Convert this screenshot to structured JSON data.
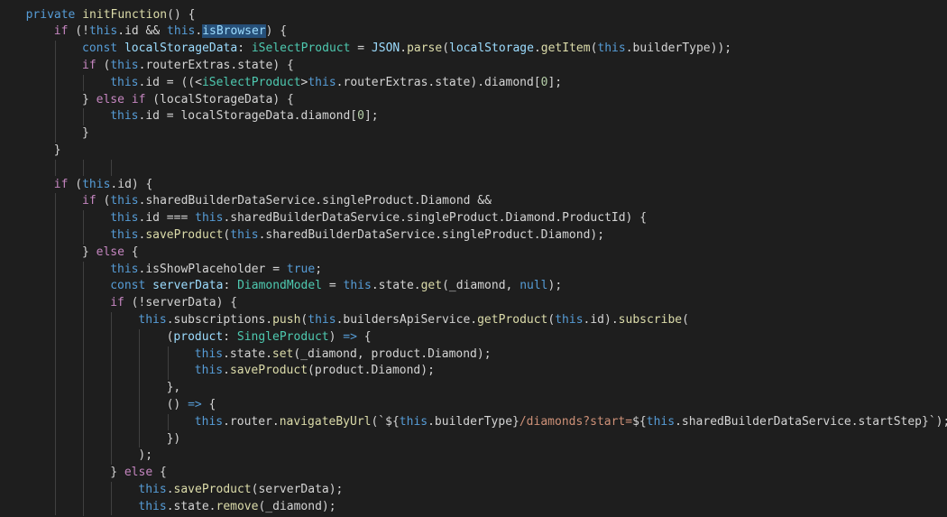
{
  "colors": {
    "background": "#1e1e1e",
    "keyword": "#569cd6",
    "control": "#c586c0",
    "function": "#dcdcaa",
    "variable": "#9cdcfe",
    "type": "#4ec9b0",
    "number": "#b5cea8",
    "string": "#ce9178",
    "text": "#d4d4d4",
    "selection": "#264f78"
  },
  "code_lines": [
    {
      "indent": 2,
      "tokens": [
        [
          "private ",
          "kw"
        ],
        [
          "initFunction",
          "fn"
        ],
        [
          "() {",
          "p"
        ]
      ]
    },
    {
      "indent": 6,
      "tokens": [
        [
          "if ",
          "ctl"
        ],
        [
          "(!",
          "p"
        ],
        [
          "this",
          "kw"
        ],
        [
          ".id && ",
          "p"
        ],
        [
          "this",
          "kw"
        ],
        [
          ".",
          "p"
        ],
        [
          "isBrowser",
          "sel"
        ],
        [
          ") {",
          "p"
        ]
      ]
    },
    {
      "indent": 10,
      "tokens": [
        [
          "const ",
          "kw"
        ],
        [
          "localStorageData",
          "var"
        ],
        [
          ": ",
          "p"
        ],
        [
          "iSelectProduct",
          "ty"
        ],
        [
          " = ",
          "p"
        ],
        [
          "JSON",
          "var"
        ],
        [
          ".",
          "p"
        ],
        [
          "parse",
          "fn"
        ],
        [
          "(",
          "p"
        ],
        [
          "localStorage",
          "var"
        ],
        [
          ".",
          "p"
        ],
        [
          "getItem",
          "fn"
        ],
        [
          "(",
          "p"
        ],
        [
          "this",
          "kw"
        ],
        [
          ".builderType));",
          "p"
        ]
      ]
    },
    {
      "indent": 10,
      "tokens": [
        [
          "if ",
          "ctl"
        ],
        [
          "(",
          "p"
        ],
        [
          "this",
          "kw"
        ],
        [
          ".routerExtras.state) {",
          "p"
        ]
      ]
    },
    {
      "indent": 14,
      "tokens": [
        [
          "this",
          "kw"
        ],
        [
          ".id = ((<",
          "p"
        ],
        [
          "iSelectProduct",
          "ty"
        ],
        [
          ">",
          "p"
        ],
        [
          "this",
          "kw"
        ],
        [
          ".routerExtras.state).diamond[",
          "p"
        ],
        [
          "0",
          "num"
        ],
        [
          "];",
          "p"
        ]
      ]
    },
    {
      "indent": 10,
      "tokens": [
        [
          "} ",
          "p"
        ],
        [
          "else if ",
          "ctl"
        ],
        [
          "(localStorageData) {",
          "p"
        ]
      ]
    },
    {
      "indent": 14,
      "tokens": [
        [
          "this",
          "kw"
        ],
        [
          ".id = localStorageData.diamond[",
          "p"
        ],
        [
          "0",
          "num"
        ],
        [
          "];",
          "p"
        ]
      ]
    },
    {
      "indent": 10,
      "tokens": [
        [
          "}",
          "p"
        ]
      ]
    },
    {
      "indent": 6,
      "tokens": [
        [
          "}",
          "p"
        ]
      ]
    },
    {
      "indent": 0,
      "tokens": []
    },
    {
      "indent": 6,
      "tokens": [
        [
          "if ",
          "ctl"
        ],
        [
          "(",
          "p"
        ],
        [
          "this",
          "kw"
        ],
        [
          ".id) {",
          "p"
        ]
      ]
    },
    {
      "indent": 10,
      "tokens": [
        [
          "if ",
          "ctl"
        ],
        [
          "(",
          "p"
        ],
        [
          "this",
          "kw"
        ],
        [
          ".sharedBuilderDataService.singleProduct.Diamond &&",
          "p"
        ]
      ]
    },
    {
      "indent": 14,
      "tokens": [
        [
          "this",
          "kw"
        ],
        [
          ".id === ",
          "p"
        ],
        [
          "this",
          "kw"
        ],
        [
          ".sharedBuilderDataService.singleProduct.Diamond.ProductId) {",
          "p"
        ]
      ]
    },
    {
      "indent": 14,
      "tokens": [
        [
          "this",
          "kw"
        ],
        [
          ".",
          "p"
        ],
        [
          "saveProduct",
          "fn"
        ],
        [
          "(",
          "p"
        ],
        [
          "this",
          "kw"
        ],
        [
          ".sharedBuilderDataService.singleProduct.Diamond);",
          "p"
        ]
      ]
    },
    {
      "indent": 10,
      "tokens": [
        [
          "} ",
          "p"
        ],
        [
          "else ",
          "ctl"
        ],
        [
          "{",
          "p"
        ]
      ]
    },
    {
      "indent": 14,
      "tokens": [
        [
          "this",
          "kw"
        ],
        [
          ".isShowPlaceholder = ",
          "p"
        ],
        [
          "true",
          "kw"
        ],
        [
          ";",
          "p"
        ]
      ]
    },
    {
      "indent": 14,
      "tokens": [
        [
          "const ",
          "kw"
        ],
        [
          "serverData",
          "var"
        ],
        [
          ": ",
          "p"
        ],
        [
          "DiamondModel",
          "ty"
        ],
        [
          " = ",
          "p"
        ],
        [
          "this",
          "kw"
        ],
        [
          ".state.",
          "p"
        ],
        [
          "get",
          "fn"
        ],
        [
          "(_diamond, ",
          "p"
        ],
        [
          "null",
          "kw"
        ],
        [
          ");",
          "p"
        ]
      ]
    },
    {
      "indent": 14,
      "tokens": [
        [
          "if ",
          "ctl"
        ],
        [
          "(!serverData) {",
          "p"
        ]
      ]
    },
    {
      "indent": 18,
      "tokens": [
        [
          "this",
          "kw"
        ],
        [
          ".subscriptions.",
          "p"
        ],
        [
          "push",
          "fn"
        ],
        [
          "(",
          "p"
        ],
        [
          "this",
          "kw"
        ],
        [
          ".buildersApiService.",
          "p"
        ],
        [
          "getProduct",
          "fn"
        ],
        [
          "(",
          "p"
        ],
        [
          "this",
          "kw"
        ],
        [
          ".id).",
          "p"
        ],
        [
          "subscribe",
          "fn"
        ],
        [
          "(",
          "p"
        ]
      ]
    },
    {
      "indent": 22,
      "tokens": [
        [
          "(",
          "p"
        ],
        [
          "product",
          "var"
        ],
        [
          ": ",
          "p"
        ],
        [
          "SingleProduct",
          "ty"
        ],
        [
          ") ",
          "p"
        ],
        [
          "=>",
          "kw"
        ],
        [
          " {",
          "p"
        ]
      ]
    },
    {
      "indent": 26,
      "tokens": [
        [
          "this",
          "kw"
        ],
        [
          ".state.",
          "p"
        ],
        [
          "set",
          "fn"
        ],
        [
          "(_diamond, product.Diamond);",
          "p"
        ]
      ]
    },
    {
      "indent": 26,
      "tokens": [
        [
          "this",
          "kw"
        ],
        [
          ".",
          "p"
        ],
        [
          "saveProduct",
          "fn"
        ],
        [
          "(product.Diamond);",
          "p"
        ]
      ]
    },
    {
      "indent": 22,
      "tokens": [
        [
          "},",
          "p"
        ]
      ]
    },
    {
      "indent": 22,
      "tokens": [
        [
          "() ",
          "p"
        ],
        [
          "=>",
          "kw"
        ],
        [
          " {",
          "p"
        ]
      ]
    },
    {
      "indent": 26,
      "tokens": [
        [
          "this",
          "kw"
        ],
        [
          ".router.",
          "p"
        ],
        [
          "navigateByUrl",
          "fn"
        ],
        [
          "(`${",
          "p"
        ],
        [
          "this",
          "kw"
        ],
        [
          ".builderType}",
          "p"
        ],
        [
          "/diamonds?start=",
          "str"
        ],
        [
          "${",
          "p"
        ],
        [
          "this",
          "kw"
        ],
        [
          ".sharedBuilderDataService.startStep}",
          "p"
        ],
        [
          "`);",
          "p"
        ]
      ]
    },
    {
      "indent": 22,
      "tokens": [
        [
          "})",
          "p"
        ]
      ]
    },
    {
      "indent": 18,
      "tokens": [
        [
          ");",
          "p"
        ]
      ]
    },
    {
      "indent": 14,
      "tokens": [
        [
          "} ",
          "p"
        ],
        [
          "else ",
          "ctl"
        ],
        [
          "{",
          "p"
        ]
      ]
    },
    {
      "indent": 18,
      "tokens": [
        [
          "this",
          "kw"
        ],
        [
          ".",
          "p"
        ],
        [
          "saveProduct",
          "fn"
        ],
        [
          "(serverData);",
          "p"
        ]
      ]
    },
    {
      "indent": 18,
      "tokens": [
        [
          "this",
          "kw"
        ],
        [
          ".state.",
          "p"
        ],
        [
          "remove",
          "fn"
        ],
        [
          "(_diamond);",
          "p"
        ]
      ]
    }
  ]
}
